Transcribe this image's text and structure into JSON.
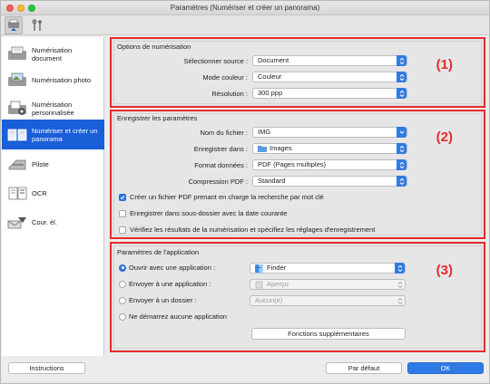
{
  "window": {
    "title": "Paramètres (Numériser et créer un panorama)"
  },
  "toolbar": {
    "scan_tab_icon": "scan-settings-icon",
    "general_tab_icon": "tools-icon"
  },
  "sidebar": {
    "items": [
      {
        "label": "Numérisation document",
        "icon": "document-scan-icon"
      },
      {
        "label": "Numérisation photo",
        "icon": "photo-scan-icon"
      },
      {
        "label": "Numérisation personnalisée",
        "icon": "custom-scan-icon"
      },
      {
        "label": "Numériser et créer un panorama",
        "icon": "panorama-icon",
        "selected": true
      },
      {
        "label": "Pilote",
        "icon": "driver-icon"
      },
      {
        "label": "OCR",
        "icon": "ocr-icon"
      },
      {
        "label": "Cour. él.",
        "icon": "email-icon"
      }
    ]
  },
  "scan_options": {
    "title": "Options de numérisation",
    "number": "(1)",
    "source_label": "Sélectionner source :",
    "source_value": "Document",
    "color_label": "Mode couleur :",
    "color_value": "Couleur",
    "resolution_label": "Résolution :",
    "resolution_value": "300 ppp"
  },
  "save_settings": {
    "title": "Enregistrer les paramètres",
    "number": "(2)",
    "filename_label": "Nom du fichier :",
    "filename_value": "IMG",
    "save_in_label": "Enregistrer dans :",
    "save_in_value": "Images",
    "format_label": "Format données :",
    "format_value": "PDF (Pages multiples)",
    "compression_label": "Compression PDF :",
    "compression_value": "Standard",
    "check_searchable": "Créer un fichier PDF prenant en charge la recherche par mot clé",
    "check_subfolder": "Enregistrer dans sous-dossier avec la date courante",
    "check_verify": "Vérifiez les résultats de la numérisation et spécifiez les réglages d'enregistrement"
  },
  "app_settings": {
    "title": "Paramètres de l'application",
    "number": "(3)",
    "radio_open": "Ouvrir avec une application :",
    "open_value": "Finder",
    "radio_send_app": "Envoyer à une application :",
    "send_app_value": "Aperçu",
    "radio_send_folder": "Envoyer à un dossier :",
    "send_folder_value": "Aucun(e)",
    "radio_none": "Ne démarrez aucune application",
    "more_functions": "Fonctions supplémentaires"
  },
  "footer": {
    "instructions": "Instructions",
    "defaults": "Par défaut",
    "ok": "OK"
  },
  "colors": {
    "accent": "#2f7ae5",
    "highlight": "#e52b2b",
    "selection": "#1a5ed8"
  }
}
